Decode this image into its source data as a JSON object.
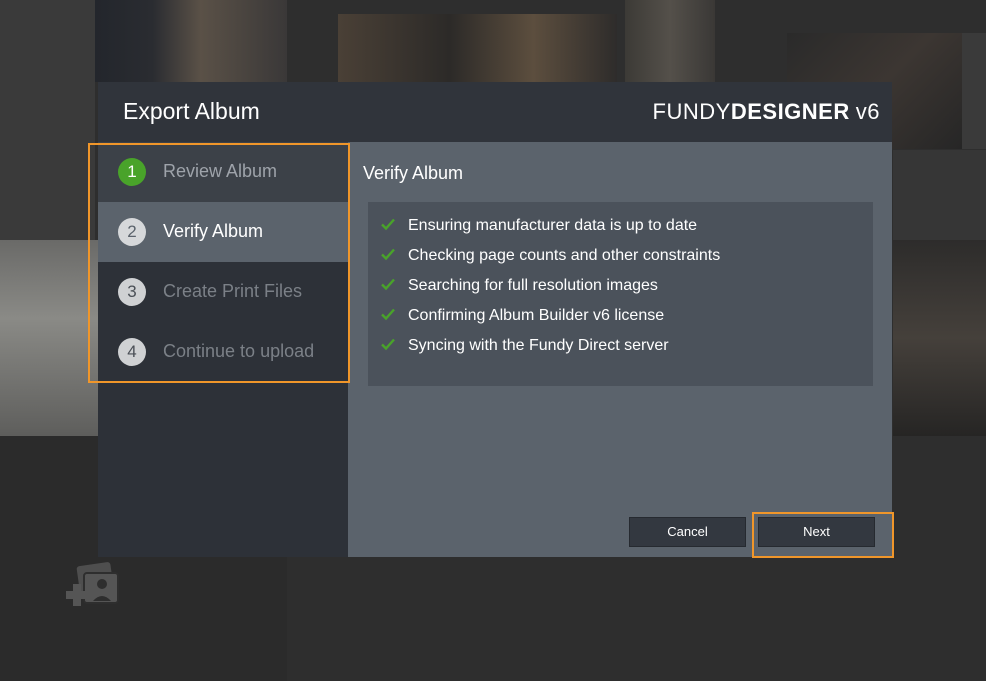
{
  "dialog": {
    "title": "Export Album",
    "brand": {
      "light": "FUNDY",
      "bold": "DESIGNER",
      "version": "v6"
    }
  },
  "steps": [
    {
      "number": "1",
      "label": "Review Album",
      "state": "complete"
    },
    {
      "number": "2",
      "label": "Verify Album",
      "state": "active"
    },
    {
      "number": "3",
      "label": "Create Print Files",
      "state": "pending"
    },
    {
      "number": "4",
      "label": "Continue to upload",
      "state": "pending"
    }
  ],
  "content": {
    "title": "Verify Album",
    "checks": [
      "Ensuring manufacturer data is up to date",
      "Checking page counts and other constraints",
      "Searching for full resolution images",
      "Confirming Album Builder v6 license",
      "Syncing with the Fundy Direct server"
    ]
  },
  "buttons": {
    "cancel": "Cancel",
    "next": "Next"
  },
  "colors": {
    "accent_highlight": "#f0962a",
    "check": "#49a32a"
  },
  "icons": {
    "check": "check-icon",
    "background": "add-photos-icon"
  }
}
